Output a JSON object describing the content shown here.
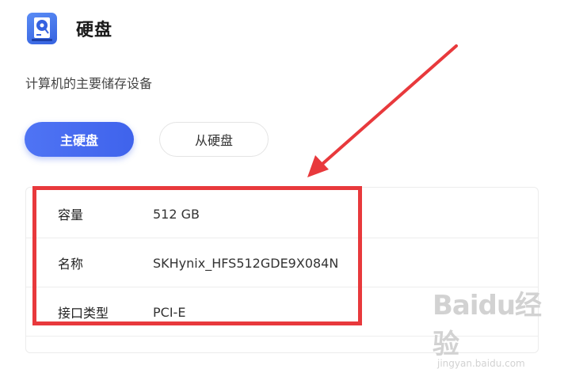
{
  "header": {
    "icon": "hard-disk-icon",
    "title": "硬盘",
    "subtitle": "计算机的主要储存设备"
  },
  "tabs": [
    {
      "label": "主硬盘",
      "active": true
    },
    {
      "label": "从硬盘",
      "active": false
    }
  ],
  "details": [
    {
      "label": "容量",
      "value": "512 GB"
    },
    {
      "label": "名称",
      "value": "SKHynix_HFS512GDE9X084N"
    },
    {
      "label": "接口类型",
      "value": "PCI-E"
    }
  ],
  "watermark": {
    "main": "Baidu经验",
    "sub": "jingyan.baidu.com"
  },
  "colors": {
    "accent": "#4f74f4",
    "highlight": "#e8393c"
  }
}
